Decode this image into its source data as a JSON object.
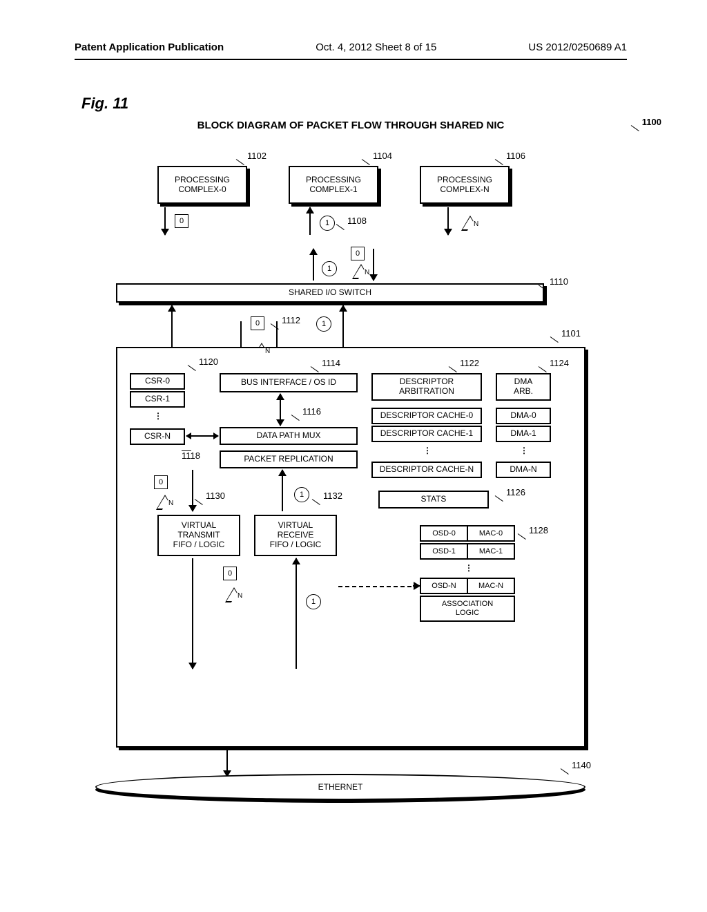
{
  "header": {
    "left": "Patent Application Publication",
    "center": "Oct. 4, 2012   Sheet 8 of 15",
    "right": "US 2012/0250689 A1"
  },
  "figure_label": "Fig. 11",
  "title": "BLOCK DIAGRAM OF PACKET FLOW THROUGH SHARED NIC",
  "refs": {
    "r1100": "1100",
    "r1101": "1101",
    "r1102": "1102",
    "r1104": "1104",
    "r1106": "1106",
    "r1108": "1108",
    "r1110": "1110",
    "r1112": "1112",
    "r1114": "1114",
    "r1116": "1116",
    "r1118": "1118",
    "r1120": "1120",
    "r1122": "1122",
    "r1124": "1124",
    "r1126": "1126",
    "r1128": "1128",
    "r1130": "1130",
    "r1132": "1132",
    "r1140": "1140"
  },
  "blocks": {
    "pc0": "PROCESSING\nCOMPLEX-0",
    "pc1": "PROCESSING\nCOMPLEX-1",
    "pcn": "PROCESSING\nCOMPLEX-N",
    "switch": "SHARED I/O SWITCH",
    "csr0": "CSR-0",
    "csr1": "CSR-1",
    "csrn": "CSR-N",
    "bus": "BUS INTERFACE / OS ID",
    "mux": "DATA PATH MUX",
    "repl": "PACKET REPLICATION",
    "darb": "DESCRIPTOR\nARBITRATION",
    "dc0": "DESCRIPTOR CACHE-0",
    "dc1": "DESCRIPTOR CACHE-1",
    "dcn": "DESCRIPTOR CACHE-N",
    "dmaarb": "DMA\nARB.",
    "dma0": "DMA-0",
    "dma1": "DMA-1",
    "dman": "DMA-N",
    "stats": "STATS",
    "vtx": "VIRTUAL\nTRANSMIT\nFIFO / LOGIC",
    "vrx": "VIRTUAL\nRECEIVE\nFIFO / LOGIC",
    "osd0": "OSD-0",
    "mac0": "MAC-0",
    "osd1": "OSD-1",
    "mac1": "MAC-1",
    "osdn": "OSD-N",
    "macn": "MAC-N",
    "assoc": "ASSOCIATION\nLOGIC",
    "eth": "ETHERNET"
  },
  "tags": {
    "zero": "0",
    "one": "1",
    "n": "N"
  }
}
